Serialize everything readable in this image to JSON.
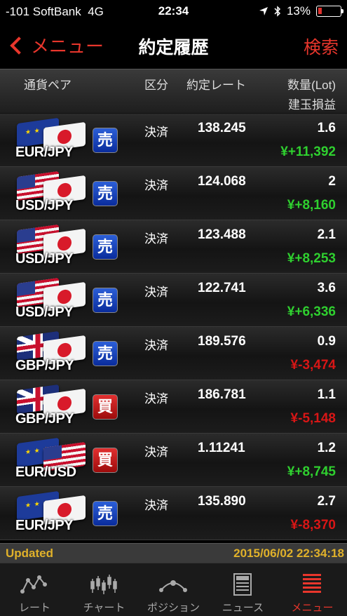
{
  "status_bar": {
    "carrier": "-101 SoftBank",
    "network": "4G",
    "time": "22:34",
    "battery": "13%"
  },
  "nav": {
    "back_label": "メニュー",
    "title": "約定履歴",
    "search_label": "検索"
  },
  "columns": {
    "pair": "通貨ペア",
    "kubun": "区分",
    "rate": "約定レート",
    "lot": "数量(Lot)",
    "pl": "建玉損益"
  },
  "trades": [
    {
      "pair": "EUR/JPY",
      "flags": [
        "eur",
        "jpy"
      ],
      "side": "売",
      "side_type": "sell",
      "kubun": "決済",
      "rate": "138.245",
      "lot": "1.6",
      "pl": "¥+11,392",
      "pl_sign": "pos"
    },
    {
      "pair": "USD/JPY",
      "flags": [
        "usd",
        "jpy"
      ],
      "side": "売",
      "side_type": "sell",
      "kubun": "決済",
      "rate": "124.068",
      "lot": "2",
      "pl": "¥+8,160",
      "pl_sign": "pos"
    },
    {
      "pair": "USD/JPY",
      "flags": [
        "usd",
        "jpy"
      ],
      "side": "売",
      "side_type": "sell",
      "kubun": "決済",
      "rate": "123.488",
      "lot": "2.1",
      "pl": "¥+8,253",
      "pl_sign": "pos"
    },
    {
      "pair": "USD/JPY",
      "flags": [
        "usd",
        "jpy"
      ],
      "side": "売",
      "side_type": "sell",
      "kubun": "決済",
      "rate": "122.741",
      "lot": "3.6",
      "pl": "¥+6,336",
      "pl_sign": "pos"
    },
    {
      "pair": "GBP/JPY",
      "flags": [
        "gbp",
        "jpy"
      ],
      "side": "売",
      "side_type": "sell",
      "kubun": "決済",
      "rate": "189.576",
      "lot": "0.9",
      "pl": "¥-3,474",
      "pl_sign": "neg"
    },
    {
      "pair": "GBP/JPY",
      "flags": [
        "gbp",
        "jpy"
      ],
      "side": "買",
      "side_type": "buy",
      "kubun": "決済",
      "rate": "186.781",
      "lot": "1.1",
      "pl": "¥-5,148",
      "pl_sign": "neg"
    },
    {
      "pair": "EUR/USD",
      "flags": [
        "eur",
        "usd"
      ],
      "side": "買",
      "side_type": "buy",
      "kubun": "決済",
      "rate": "1.11241",
      "lot": "1.2",
      "pl": "¥+8,745",
      "pl_sign": "pos"
    },
    {
      "pair": "EUR/JPY",
      "flags": [
        "eur",
        "jpy"
      ],
      "side": "売",
      "side_type": "sell",
      "kubun": "決済",
      "rate": "135.890",
      "lot": "2.7",
      "pl": "¥-8,370",
      "pl_sign": "neg"
    }
  ],
  "footer": {
    "updated_label": "Updated",
    "updated_time": "2015/06/02 22:34:18"
  },
  "tabs": [
    {
      "label": "レート",
      "icon": "rate-chart-icon",
      "active": false
    },
    {
      "label": "チャート",
      "icon": "candlestick-icon",
      "active": false
    },
    {
      "label": "ポジション",
      "icon": "position-icon",
      "active": false
    },
    {
      "label": "ニュース",
      "icon": "news-icon",
      "active": false
    },
    {
      "label": "メニュー",
      "icon": "menu-icon",
      "active": true
    }
  ],
  "colors": {
    "accent": "#e8362c",
    "profit": "#2fd02f",
    "loss": "#d81616",
    "updated": "#e0b12a",
    "sell": "#1a44c0",
    "buy": "#c41e1e"
  }
}
